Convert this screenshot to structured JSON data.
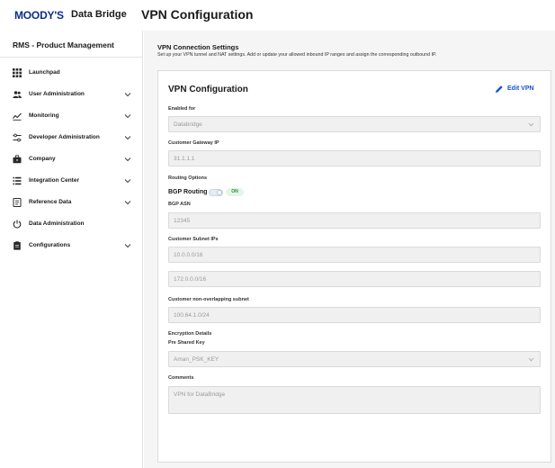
{
  "header": {
    "logo_text": "MOODY'S",
    "product_name": "Data Bridge",
    "page_title": "VPN Configuration"
  },
  "sidebar": {
    "title": "RMS - Product Management",
    "items": [
      {
        "label": "Launchpad",
        "icon": "grid-icon",
        "has_chevron": false
      },
      {
        "label": "User Administration",
        "icon": "users-icon",
        "has_chevron": true
      },
      {
        "label": "Monitoring",
        "icon": "chart-line-icon",
        "has_chevron": true
      },
      {
        "label": "Developer Administration",
        "icon": "sliders-icon",
        "has_chevron": true
      },
      {
        "label": "Company",
        "icon": "briefcase-icon",
        "has_chevron": true
      },
      {
        "label": "Integration Center",
        "icon": "list-icon",
        "has_chevron": true
      },
      {
        "label": "Reference Data",
        "icon": "book-icon",
        "has_chevron": true
      },
      {
        "label": "Data Administration",
        "icon": "power-icon",
        "has_chevron": false
      },
      {
        "label": "Configurations",
        "icon": "clipboard-icon",
        "has_chevron": true
      }
    ]
  },
  "main": {
    "section_title": "VPN Connection Settings",
    "section_desc": "Set up your VPN tunnel and NAT settings. Add or update your allowed inbound IP ranges and assign the corresponding outbound IP.",
    "card": {
      "title": "VPN Configuration",
      "edit_label": "Edit VPN",
      "enabled_for_label": "Enabled for",
      "enabled_for_value": "Databridge",
      "customer_gateway_label": "Customer Gateway IP",
      "customer_gateway_value": "31.1.1.1",
      "routing_options_label": "Routing Options",
      "bgp_routing_label": "BGP Routing",
      "bgp_toggle_state": "ON",
      "bgp_asn_label": "BGP ASN",
      "bgp_asn_value": "12345",
      "customer_subnet_label": "Customer Subnet IPs",
      "customer_subnet_values": [
        "10.0.0.0/16",
        "172.0.0.0/16"
      ],
      "non_overlapping_label": "Customer non-overlapping subnet",
      "non_overlapping_value": "100.64.1.0/24",
      "encryption_label": "Encryption Details",
      "psk_label": "Pre Shared Key",
      "psk_value": "Aman_PSK_KEY",
      "comments_label": "Comments",
      "comments_value": "VPN for DataBridge"
    }
  },
  "colors": {
    "brand": "#0b2c8c",
    "accent": "#1553d1",
    "toggle_on": "#2e8b3a"
  }
}
